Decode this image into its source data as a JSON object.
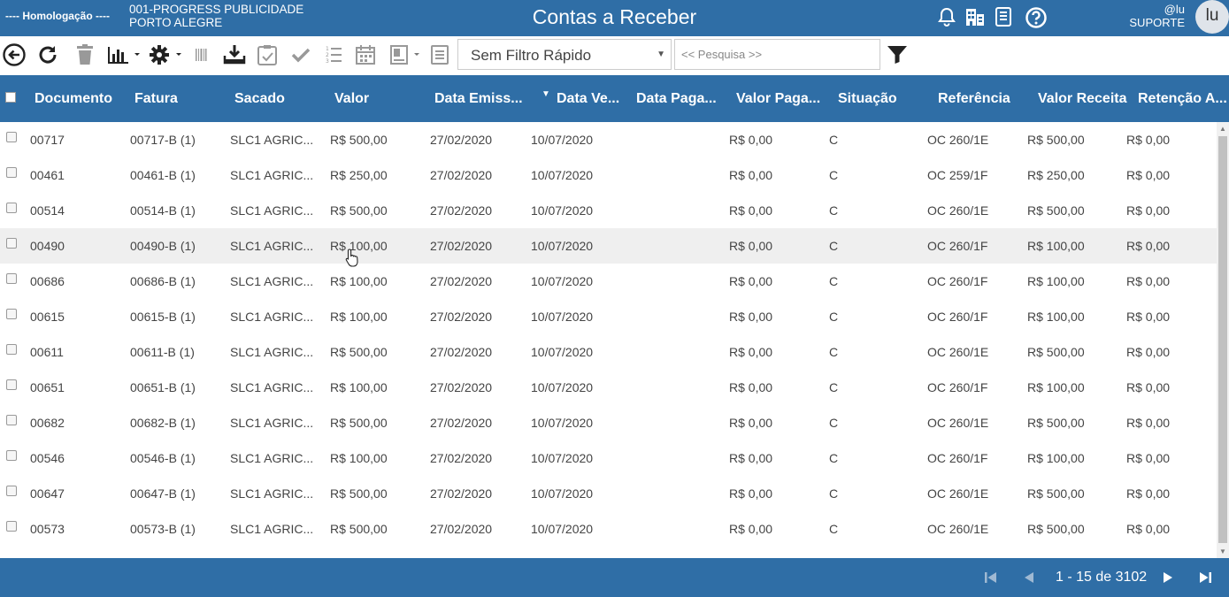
{
  "header": {
    "environment": "---- Homologação ----",
    "company_line1": "001-PROGRESS PUBLICIDADE",
    "company_line2": "PORTO ALEGRE",
    "title": "Contas a Receber",
    "icons": [
      "bell-icon",
      "building-icon",
      "document-icon",
      "help-icon"
    ],
    "user_handle": "@lu",
    "user_role": "SUPORTE",
    "avatar_initials": "lu",
    "color": "#2f6ea6"
  },
  "toolbar": {
    "icons": [
      "back-icon",
      "refresh-icon",
      "trash-icon",
      "chart-icon",
      "settings-icon",
      "barcode-icon",
      "download-icon",
      "clipboard-check-icon",
      "check-icon",
      "list-numbered-icon",
      "calendar-icon",
      "form-icon",
      "list-icon",
      "filter-icon"
    ],
    "quick_filter": "Sem Filtro Rápido",
    "search_placeholder": "<< Pesquisa >>"
  },
  "grid": {
    "columns": [
      "Documento",
      "Fatura",
      "Sacado",
      "Valor",
      "Data Emiss...",
      "Data Ve...",
      "Data Paga...",
      "Valor Paga...",
      "Situação",
      "Referência",
      "Valor Receita",
      "Retenção A..."
    ],
    "sorted_column": "Data Ve...",
    "rows": [
      [
        "00717",
        "00717-B (1)",
        "SLC1 AGRIC...",
        "R$ 500,00",
        "27/02/2020",
        "10/07/2020",
        "",
        "R$ 0,00",
        "C",
        "OC 260/1E",
        "R$ 500,00",
        "R$ 0,00"
      ],
      [
        "00461",
        "00461-B (1)",
        "SLC1 AGRIC...",
        "R$ 250,00",
        "27/02/2020",
        "10/07/2020",
        "",
        "R$ 0,00",
        "C",
        "OC 259/1F",
        "R$ 250,00",
        "R$ 0,00"
      ],
      [
        "00514",
        "00514-B (1)",
        "SLC1 AGRIC...",
        "R$ 500,00",
        "27/02/2020",
        "10/07/2020",
        "",
        "R$ 0,00",
        "C",
        "OC 260/1E",
        "R$ 500,00",
        "R$ 0,00"
      ],
      [
        "00490",
        "00490-B (1)",
        "SLC1 AGRIC...",
        "R$ 100,00",
        "27/02/2020",
        "10/07/2020",
        "",
        "R$ 0,00",
        "C",
        "OC 260/1F",
        "R$ 100,00",
        "R$ 0,00"
      ],
      [
        "00686",
        "00686-B (1)",
        "SLC1 AGRIC...",
        "R$ 100,00",
        "27/02/2020",
        "10/07/2020",
        "",
        "R$ 0,00",
        "C",
        "OC 260/1F",
        "R$ 100,00",
        "R$ 0,00"
      ],
      [
        "00615",
        "00615-B (1)",
        "SLC1 AGRIC...",
        "R$ 100,00",
        "27/02/2020",
        "10/07/2020",
        "",
        "R$ 0,00",
        "C",
        "OC 260/1F",
        "R$ 100,00",
        "R$ 0,00"
      ],
      [
        "00611",
        "00611-B (1)",
        "SLC1 AGRIC...",
        "R$ 500,00",
        "27/02/2020",
        "10/07/2020",
        "",
        "R$ 0,00",
        "C",
        "OC 260/1E",
        "R$ 500,00",
        "R$ 0,00"
      ],
      [
        "00651",
        "00651-B (1)",
        "SLC1 AGRIC...",
        "R$ 100,00",
        "27/02/2020",
        "10/07/2020",
        "",
        "R$ 0,00",
        "C",
        "OC 260/1F",
        "R$ 100,00",
        "R$ 0,00"
      ],
      [
        "00682",
        "00682-B (1)",
        "SLC1 AGRIC...",
        "R$ 500,00",
        "27/02/2020",
        "10/07/2020",
        "",
        "R$ 0,00",
        "C",
        "OC 260/1E",
        "R$ 500,00",
        "R$ 0,00"
      ],
      [
        "00546",
        "00546-B (1)",
        "SLC1 AGRIC...",
        "R$ 100,00",
        "27/02/2020",
        "10/07/2020",
        "",
        "R$ 0,00",
        "C",
        "OC 260/1F",
        "R$ 100,00",
        "R$ 0,00"
      ],
      [
        "00647",
        "00647-B (1)",
        "SLC1 AGRIC...",
        "R$ 500,00",
        "27/02/2020",
        "10/07/2020",
        "",
        "R$ 0,00",
        "C",
        "OC 260/1E",
        "R$ 500,00",
        "R$ 0,00"
      ],
      [
        "00573",
        "00573-B (1)",
        "SLC1 AGRIC...",
        "R$ 500,00",
        "27/02/2020",
        "10/07/2020",
        "",
        "R$ 0,00",
        "C",
        "OC 260/1E",
        "R$ 500,00",
        "R$ 0,00"
      ]
    ],
    "highlighted_row": 3
  },
  "footer": {
    "page_info": "1 - 15 de 3102",
    "icons": [
      "first-page-icon",
      "prev-page-icon",
      "next-page-icon",
      "last-page-icon"
    ]
  }
}
